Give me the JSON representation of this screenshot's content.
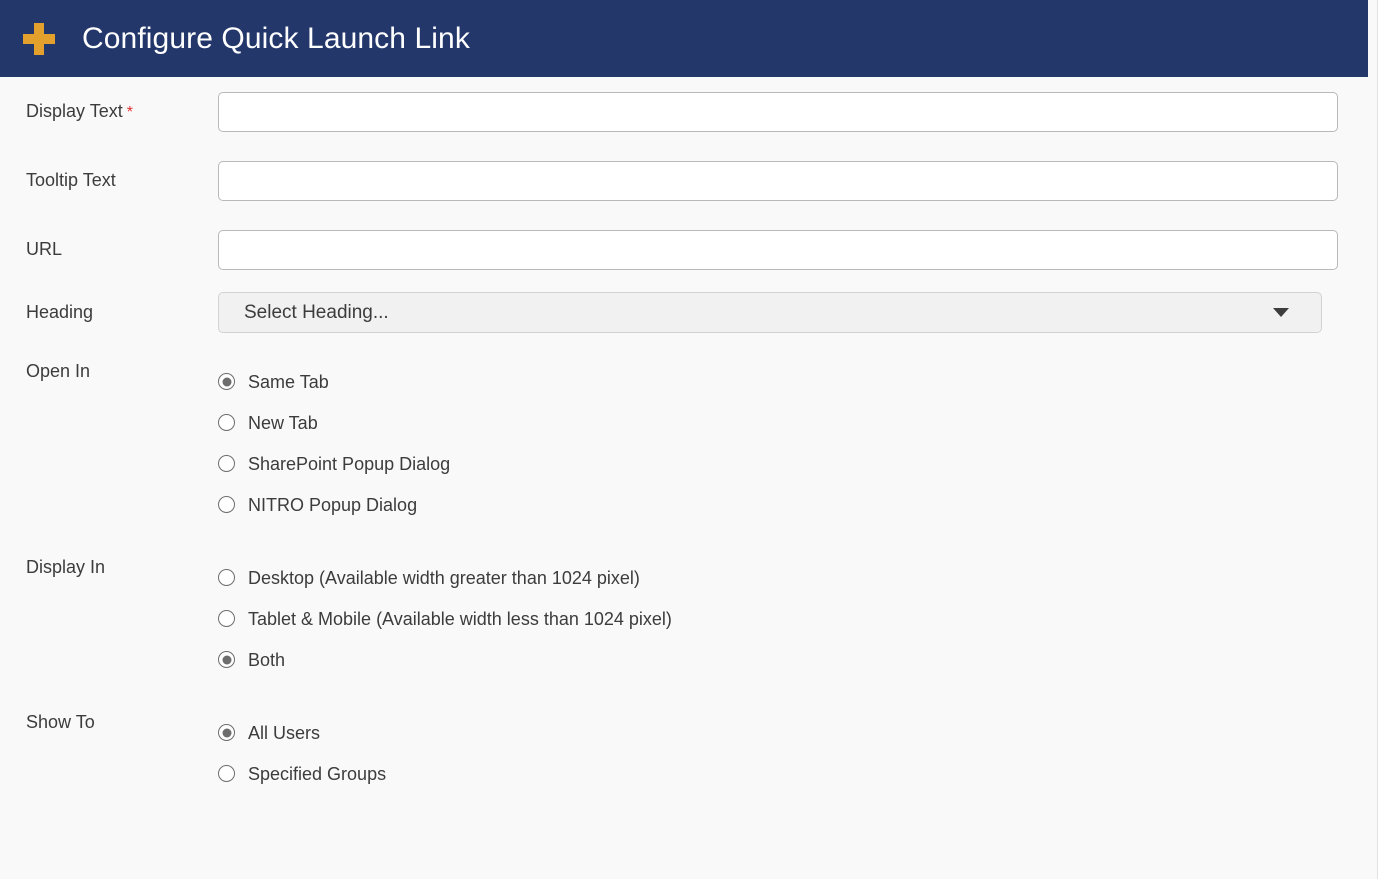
{
  "header": {
    "icon": "plus-icon",
    "title": "Configure Quick Launch Link",
    "background_color": "#23376b",
    "icon_color": "#e4a02c",
    "title_color": "#ffffff"
  },
  "form": {
    "display_text": {
      "label": "Display Text",
      "required_marker": "*",
      "value": "",
      "placeholder": ""
    },
    "tooltip_text": {
      "label": "Tooltip Text",
      "value": "",
      "placeholder": ""
    },
    "url": {
      "label": "URL",
      "value": "",
      "placeholder": ""
    },
    "heading": {
      "label": "Heading",
      "selected": "Select Heading...",
      "caret": "chevron-down-icon"
    },
    "open_in": {
      "label": "Open In",
      "options": [
        {
          "label": "Same Tab",
          "checked": true
        },
        {
          "label": "New Tab",
          "checked": false
        },
        {
          "label": "SharePoint Popup Dialog",
          "checked": false
        },
        {
          "label": "NITRO Popup Dialog",
          "checked": false
        }
      ]
    },
    "display_in": {
      "label": "Display In",
      "options": [
        {
          "label": "Desktop (Available width greater than 1024 pixel)",
          "checked": false
        },
        {
          "label": "Tablet & Mobile (Available width less than 1024 pixel)",
          "checked": false
        },
        {
          "label": "Both",
          "checked": true
        }
      ]
    },
    "show_to": {
      "label": "Show To",
      "options": [
        {
          "label": "All Users",
          "checked": true
        },
        {
          "label": "Specified Groups",
          "checked": false
        }
      ]
    }
  },
  "colors": {
    "page_background": "#f9f9f9",
    "required_asterisk": "#e03030",
    "label_text": "#3c3c3c",
    "input_border": "#b9b9b9",
    "select_background": "#f1f1f1"
  }
}
